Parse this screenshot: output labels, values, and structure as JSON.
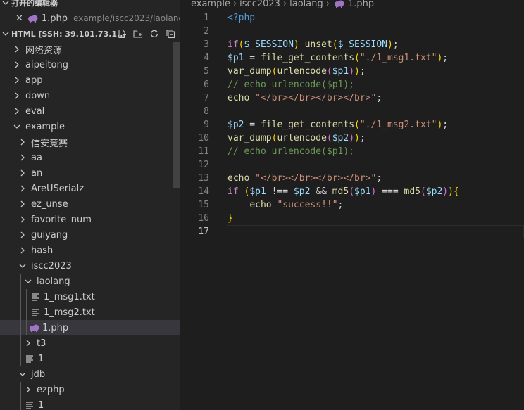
{
  "sidebar": {
    "open_editors_title": "打开的编辑器",
    "open_editor": {
      "name": "1.php",
      "path": "example/iscc2023/laolang"
    },
    "workspace_title": "HTML [SSH: 39.101.73.1...",
    "actions": [
      "new-file-icon",
      "new-folder-icon",
      "refresh-icon",
      "collapse-all-icon"
    ],
    "tree": [
      {
        "label": "网络资源",
        "type": "folder-collapsed",
        "depth": 0
      },
      {
        "label": "aipeitong",
        "type": "folder-collapsed",
        "depth": 0
      },
      {
        "label": "app",
        "type": "folder-collapsed",
        "depth": 0
      },
      {
        "label": "down",
        "type": "folder-collapsed",
        "depth": 0
      },
      {
        "label": "eval",
        "type": "folder-collapsed",
        "depth": 0
      },
      {
        "label": "example",
        "type": "folder-expanded",
        "depth": 0
      },
      {
        "label": "信安竞赛",
        "type": "folder-collapsed",
        "depth": 1
      },
      {
        "label": "aa",
        "type": "folder-collapsed",
        "depth": 1
      },
      {
        "label": "an",
        "type": "folder-collapsed",
        "depth": 1
      },
      {
        "label": "AreUSerialz",
        "type": "folder-collapsed",
        "depth": 1
      },
      {
        "label": "ez_unse",
        "type": "folder-collapsed",
        "depth": 1
      },
      {
        "label": "favorite_num",
        "type": "folder-collapsed",
        "depth": 1
      },
      {
        "label": "guiyang",
        "type": "folder-collapsed",
        "depth": 1
      },
      {
        "label": "hash",
        "type": "folder-collapsed",
        "depth": 1
      },
      {
        "label": "iscc2023",
        "type": "folder-expanded",
        "depth": 1
      },
      {
        "label": "laolang",
        "type": "folder-expanded",
        "depth": 2
      },
      {
        "label": "1_msg1.txt",
        "type": "text-file",
        "depth": 3
      },
      {
        "label": "1_msg2.txt",
        "type": "text-file",
        "depth": 3
      },
      {
        "label": "1.php",
        "type": "php-file",
        "depth": 3
      },
      {
        "label": "t3",
        "type": "folder-collapsed",
        "depth": 2
      },
      {
        "label": "1",
        "type": "text-file",
        "depth": 2
      },
      {
        "label": "jdb",
        "type": "folder-expanded",
        "depth": 1
      },
      {
        "label": "ezphp",
        "type": "folder-collapsed",
        "depth": 2
      },
      {
        "label": "1",
        "type": "text-file",
        "depth": 2
      }
    ]
  },
  "editor": {
    "breadcrumb": [
      "example",
      "iscc2023",
      "laolang",
      "1.php"
    ],
    "active_line": 17,
    "lines": [
      [
        [
          "<?php",
          "tag"
        ]
      ],
      [],
      [
        [
          "if",
          "kw"
        ],
        [
          "(",
          "br1"
        ],
        [
          "$_SESSION",
          "var"
        ],
        [
          ")",
          "br1"
        ],
        [
          " ",
          "plain"
        ],
        [
          "unset",
          "fn"
        ],
        [
          "(",
          "br1"
        ],
        [
          "$_SESSION",
          "var"
        ],
        [
          ")",
          "br1"
        ],
        [
          ";",
          "plain"
        ]
      ],
      [
        [
          "$p1",
          "var"
        ],
        [
          " = ",
          "plain"
        ],
        [
          "file_get_contents",
          "fn"
        ],
        [
          "(",
          "br1"
        ],
        [
          "\"./1_msg1.txt\"",
          "str"
        ],
        [
          ")",
          "br1"
        ],
        [
          ";",
          "plain"
        ]
      ],
      [
        [
          "var_dump",
          "fn"
        ],
        [
          "(",
          "br1"
        ],
        [
          "urlencode",
          "fn"
        ],
        [
          "(",
          "br2"
        ],
        [
          "$p1",
          "var"
        ],
        [
          ")",
          "br2"
        ],
        [
          ")",
          "br1"
        ],
        [
          ";",
          "plain"
        ]
      ],
      [
        [
          "// echo urlencode($p1);",
          "com"
        ]
      ],
      [
        [
          "echo",
          "fn"
        ],
        [
          " ",
          "plain"
        ],
        [
          "\"</br></br></br></br>\"",
          "str"
        ],
        [
          ";",
          "plain"
        ]
      ],
      [],
      [
        [
          "$p2",
          "var"
        ],
        [
          " = ",
          "plain"
        ],
        [
          "file_get_contents",
          "fn"
        ],
        [
          "(",
          "br1"
        ],
        [
          "\"./1_msg2.txt\"",
          "str"
        ],
        [
          ")",
          "br1"
        ],
        [
          ";",
          "plain"
        ]
      ],
      [
        [
          "var_dump",
          "fn"
        ],
        [
          "(",
          "br1"
        ],
        [
          "urlencode",
          "fn"
        ],
        [
          "(",
          "br2"
        ],
        [
          "$p2",
          "var"
        ],
        [
          ")",
          "br2"
        ],
        [
          ")",
          "br1"
        ],
        [
          ";",
          "plain"
        ]
      ],
      [
        [
          "// echo urlencode($p1);",
          "com"
        ]
      ],
      [],
      [
        [
          "echo",
          "fn"
        ],
        [
          " ",
          "plain"
        ],
        [
          "\"</br></br></br></br>\"",
          "str"
        ],
        [
          ";",
          "plain"
        ]
      ],
      [
        [
          "if",
          "kw"
        ],
        [
          " ",
          "plain"
        ],
        [
          "(",
          "br1"
        ],
        [
          "$p1",
          "var"
        ],
        [
          " !== ",
          "plain"
        ],
        [
          "$p2",
          "var"
        ],
        [
          " && ",
          "plain"
        ],
        [
          "md5",
          "fn"
        ],
        [
          "(",
          "br2"
        ],
        [
          "$p1",
          "var"
        ],
        [
          ")",
          "br2"
        ],
        [
          " === ",
          "plain"
        ],
        [
          "md5",
          "fn"
        ],
        [
          "(",
          "br2"
        ],
        [
          "$p2",
          "var"
        ],
        [
          ")",
          "br2"
        ],
        [
          ")",
          "br1"
        ],
        [
          "{",
          "br1"
        ]
      ],
      [
        [
          "    ",
          "plain"
        ],
        [
          "echo",
          "fn"
        ],
        [
          " ",
          "plain"
        ],
        [
          "\"success!!\"",
          "str"
        ],
        [
          ";",
          "plain"
        ]
      ],
      [
        [
          "}",
          "br1"
        ]
      ],
      []
    ]
  },
  "colors": {
    "sidebar_bg": "#252526",
    "editor_bg": "#1e1e1e",
    "selection_bg": "#37373d",
    "php_icon": "#a074c4",
    "text_icon": "#c5c5c5"
  }
}
